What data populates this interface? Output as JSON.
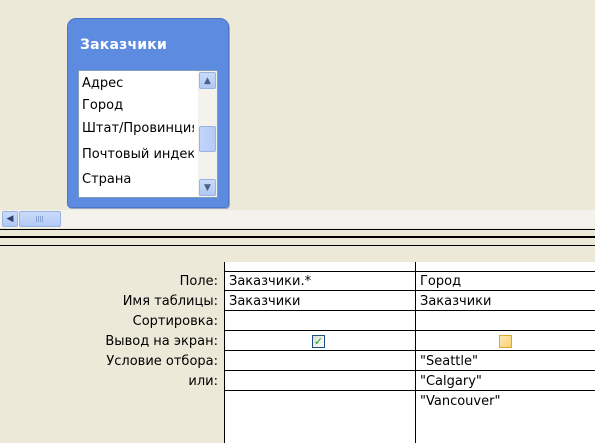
{
  "field_list": {
    "title": "Заказчики",
    "items": [
      "Адрес",
      "Город",
      "Штат/Провинция",
      "Почтовый индекс",
      "Страна"
    ]
  },
  "scroll_icons": {
    "up": "chevron-up-icon",
    "down": "chevron-down-icon",
    "left": "chevron-left-icon"
  },
  "grid": {
    "row_labels": [
      "Поле:",
      "Имя таблицы:",
      "Сортировка:",
      "Вывод на экран:",
      "Условие отбора:",
      "или:"
    ],
    "columns": [
      {
        "field": "Заказчики.*",
        "table": "Заказчики",
        "sort": "",
        "show": true,
        "criteria": "",
        "or": "",
        "extra": ""
      },
      {
        "field": "Город",
        "table": "Заказчики",
        "sort": "",
        "show": false,
        "criteria": "\"Seattle\"",
        "or": "\"Calgary\"",
        "extra": "\"Vancouver\""
      }
    ]
  },
  "colors": {
    "field_list_header": "#5d8be0",
    "background": "#ece9d8",
    "check": "#21a121"
  }
}
